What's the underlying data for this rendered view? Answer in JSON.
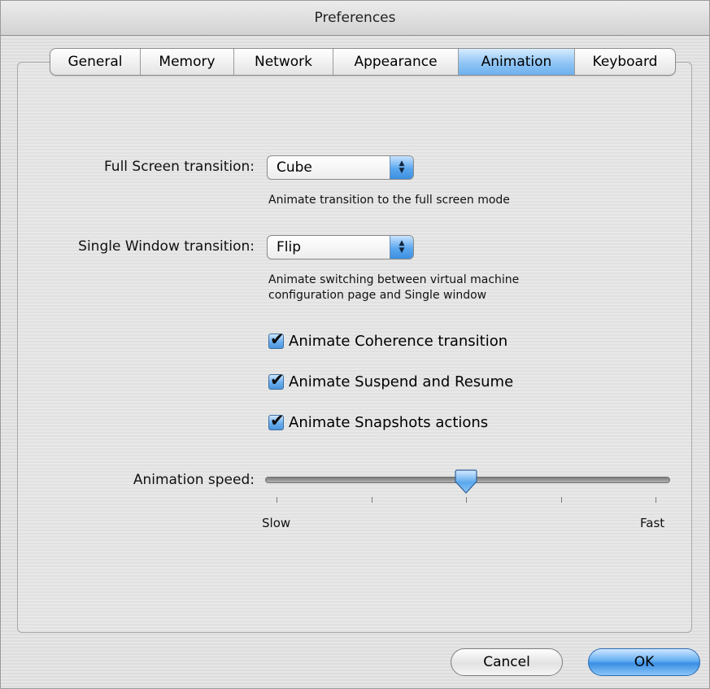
{
  "window": {
    "title": "Preferences"
  },
  "tabs": [
    {
      "label": "General",
      "active": false
    },
    {
      "label": "Memory",
      "active": false
    },
    {
      "label": "Network",
      "active": false
    },
    {
      "label": "Appearance",
      "active": false
    },
    {
      "label": "Animation",
      "active": true
    },
    {
      "label": "Keyboard",
      "active": false
    }
  ],
  "full_screen": {
    "label": "Full Screen transition:",
    "value": "Cube",
    "description": "Animate transition to the full screen mode"
  },
  "single_window": {
    "label": "Single Window transition:",
    "value": "Flip",
    "description_line1": "Animate switching between virtual machine",
    "description_line2": "configuration page and Single window"
  },
  "checkboxes": [
    {
      "label": "Animate Coherence transition",
      "checked": true
    },
    {
      "label": "Animate Suspend and Resume",
      "checked": true
    },
    {
      "label": "Animate Snapshots actions",
      "checked": true
    }
  ],
  "speed": {
    "label": "Animation speed:",
    "min_label": "Slow",
    "max_label": "Fast",
    "value": 0.5,
    "ticks": 5
  },
  "buttons": {
    "cancel": "Cancel",
    "ok": "OK"
  },
  "colors": {
    "accent": "#5aa7ee"
  }
}
